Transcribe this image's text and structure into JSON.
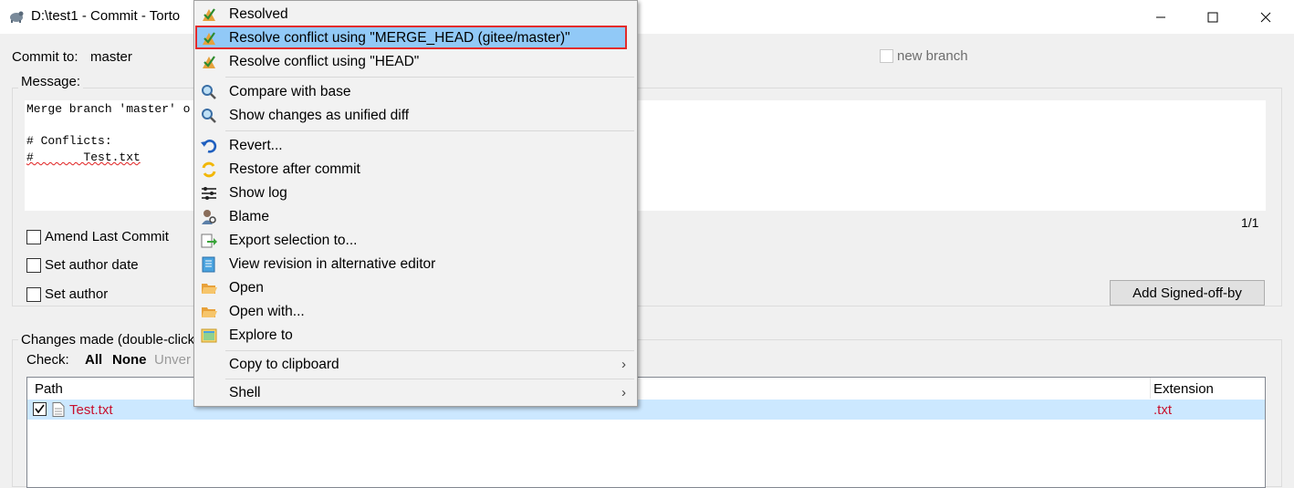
{
  "window": {
    "title": "D:\\test1 - Commit - Torto",
    "controls": [
      "minimize-icon",
      "maximize-icon",
      "close-icon"
    ]
  },
  "commit": {
    "commit_to_label": "Commit to:",
    "branch": "master",
    "new_branch_label": "new branch"
  },
  "message": {
    "label": "Message:",
    "lines": [
      "Merge branch 'master' o",
      "",
      "# Conflicts:",
      "#       Test.txt"
    ],
    "counter": "1/1"
  },
  "options": {
    "amend": "Amend Last Commit",
    "author_date": "Set author date",
    "author": "Set author"
  },
  "signoff_button": "Add Signed-off-by",
  "changes": {
    "label": "Changes made (double-click c",
    "check_label": "Check:",
    "all": "All",
    "none": "None",
    "unversioned": "Unver",
    "columns": {
      "path": "Path",
      "extension": "Extension"
    },
    "rows": [
      {
        "path": "Test.txt",
        "extension": ".txt",
        "checked": true
      }
    ]
  },
  "context_menu": {
    "items": [
      {
        "label": "Resolved",
        "icon": "resolve-icon"
      },
      {
        "label": "Resolve conflict using \"MERGE_HEAD (gitee/master)\"",
        "icon": "resolve-icon",
        "highlighted": true
      },
      {
        "label": "Resolve conflict using \"HEAD\"",
        "icon": "resolve-icon"
      },
      {
        "label": "Compare with base",
        "icon": "magnifier-icon"
      },
      {
        "label": "Show changes as unified diff",
        "icon": "magnifier-icon"
      },
      {
        "label": "Revert...",
        "icon": "revert-icon"
      },
      {
        "label": "Restore after commit",
        "icon": "restore-icon"
      },
      {
        "label": "Show log",
        "icon": "log-icon"
      },
      {
        "label": "Blame",
        "icon": "blame-icon"
      },
      {
        "label": "Export selection to...",
        "icon": "export-icon"
      },
      {
        "label": "View revision in alternative editor",
        "icon": "editor-icon"
      },
      {
        "label": "Open",
        "icon": "folder-open-icon"
      },
      {
        "label": "Open with...",
        "icon": "folder-open-icon"
      },
      {
        "label": "Explore to",
        "icon": "explore-icon"
      },
      {
        "label": "Copy to clipboard",
        "icon": ""
      },
      {
        "label": "Shell",
        "icon": ""
      }
    ]
  },
  "colors": {
    "highlight": "#91c9f7",
    "highlight_border": "#e32b2b",
    "conflict_text": "#c8102e",
    "row_selected": "#cce8ff"
  }
}
